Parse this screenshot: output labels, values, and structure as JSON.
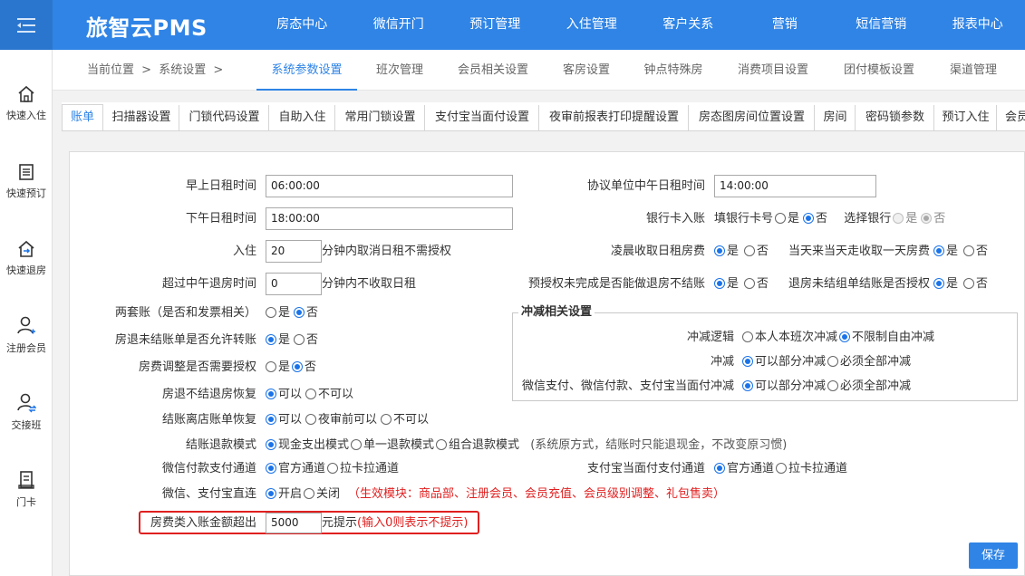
{
  "app": {
    "brand": "旅智云PMS"
  },
  "topnav": [
    "房态中心",
    "微信开门",
    "预订管理",
    "入住管理",
    "客户关系",
    "营销",
    "短信营销",
    "报表中心"
  ],
  "sidebar": [
    {
      "label": "快速入住",
      "icon": "home-icon"
    },
    {
      "label": "快速预订",
      "icon": "booking-list-icon"
    },
    {
      "label": "快速退房",
      "icon": "checkout-icon"
    },
    {
      "label": "注册会员",
      "icon": "add-user-icon"
    },
    {
      "label": "交接班",
      "icon": "shift-handover-icon"
    },
    {
      "label": "门卡",
      "icon": "room-card-icon"
    }
  ],
  "breadcrumb": {
    "current": "当前位置",
    "sep1": ">",
    "section": "系统设置",
    "sep2": ">"
  },
  "subnav": [
    "系统参数设置",
    "班次管理",
    "会员相关设置",
    "客房设置",
    "钟点特殊房",
    "消费项目设置",
    "团付模板设置",
    "渠道管理"
  ],
  "tabs": [
    "账单",
    "扫描器设置",
    "门锁代码设置",
    "自助入住",
    "常用门锁设置",
    "支付宝当面付设置",
    "夜审前报表打印提醒设置",
    "房态图房间位置设置",
    "房间",
    "密码锁参数",
    "预订入住",
    "会员"
  ],
  "form": {
    "morning_rent_time": {
      "label": "早上日租时间",
      "value": "06:00:00"
    },
    "agreement_noon_rent_time": {
      "label": "协议单位中午日租时间",
      "value": "14:00:00"
    },
    "afternoon_rent_time": {
      "label": "下午日租时间",
      "value": "18:00:00"
    },
    "bank_card": {
      "label": "银行卡入账",
      "fill_card": "填银行卡号",
      "choose_bank": "选择银行"
    },
    "checkin": {
      "label": "入住",
      "value": "20",
      "suffix": "分钟内取消日租不需授权"
    },
    "early_morning_fee": {
      "label": "凌晨收取日租房费"
    },
    "same_day_fee": {
      "label": "当天来当天走收取一天房费"
    },
    "noon_checkout": {
      "label": "超过中午退房时间",
      "value": "0",
      "suffix": "分钟内不收取日租"
    },
    "preauth": {
      "label": "预授权未完成是否能做退房不结账"
    },
    "group_checkout": {
      "label": "退房未结组单结账是否授权"
    },
    "two_accounts": {
      "label": "两套账（是否和发票相关）"
    },
    "transfer_unsettled": {
      "label": "房退未结账单是否允许转账"
    },
    "room_fee_adjust": {
      "label": "房费调整是否需要授权"
    },
    "restore_unsettled": {
      "label": "房退不结退房恢复",
      "opt_yes": "可以",
      "opt_no": "不可以"
    },
    "restore_departed": {
      "label": "结账离店账单恢复",
      "opt_yes": "可以",
      "opt_before": "夜审前可以",
      "opt_no": "不可以"
    },
    "refund_mode": {
      "label": "结账退款模式",
      "opt1": "现金支出模式",
      "opt2": "单一退款模式",
      "opt3": "组合退款模式",
      "note": "(系统原方式，结账时只能退现金，不改变原习惯)"
    },
    "wechat_channel": {
      "label": "微信付款支付通道",
      "opt1": "官方通道",
      "opt2": "拉卡拉通道"
    },
    "alipay_channel": {
      "label": "支付宝当面付支付通道",
      "opt1": "官方通道",
      "opt2": "拉卡拉通道"
    },
    "direct_pay": {
      "label": "微信、支付宝直连",
      "opt_on": "开启",
      "opt_off": "关闭",
      "note": "（生效模块：商品部、注册会员、会员充值、会员级别调整、礼包售卖）"
    },
    "room_fee_alert": {
      "label": "房费类入账金额超出",
      "value": "5000",
      "suffix": "元提示",
      "note": "(输入0则表示不提示)"
    }
  },
  "offset": {
    "title": "冲减相关设置",
    "logic": {
      "label": "冲减逻辑",
      "opt1": "本人本班次冲减",
      "opt2": "不限制自由冲减"
    },
    "offset": {
      "label": "冲减",
      "opt1": "可以部分冲减",
      "opt2": "必须全部冲减"
    },
    "pay_offset": {
      "label": "微信支付、微信付款、支付宝当面付冲减",
      "opt1": "可以部分冲减",
      "opt2": "必须全部冲减"
    }
  },
  "common": {
    "yes": "是",
    "no": "否"
  },
  "actions": {
    "save": "保存"
  },
  "colors": {
    "primary": "#2f84e6",
    "highlight": "#e02020"
  }
}
